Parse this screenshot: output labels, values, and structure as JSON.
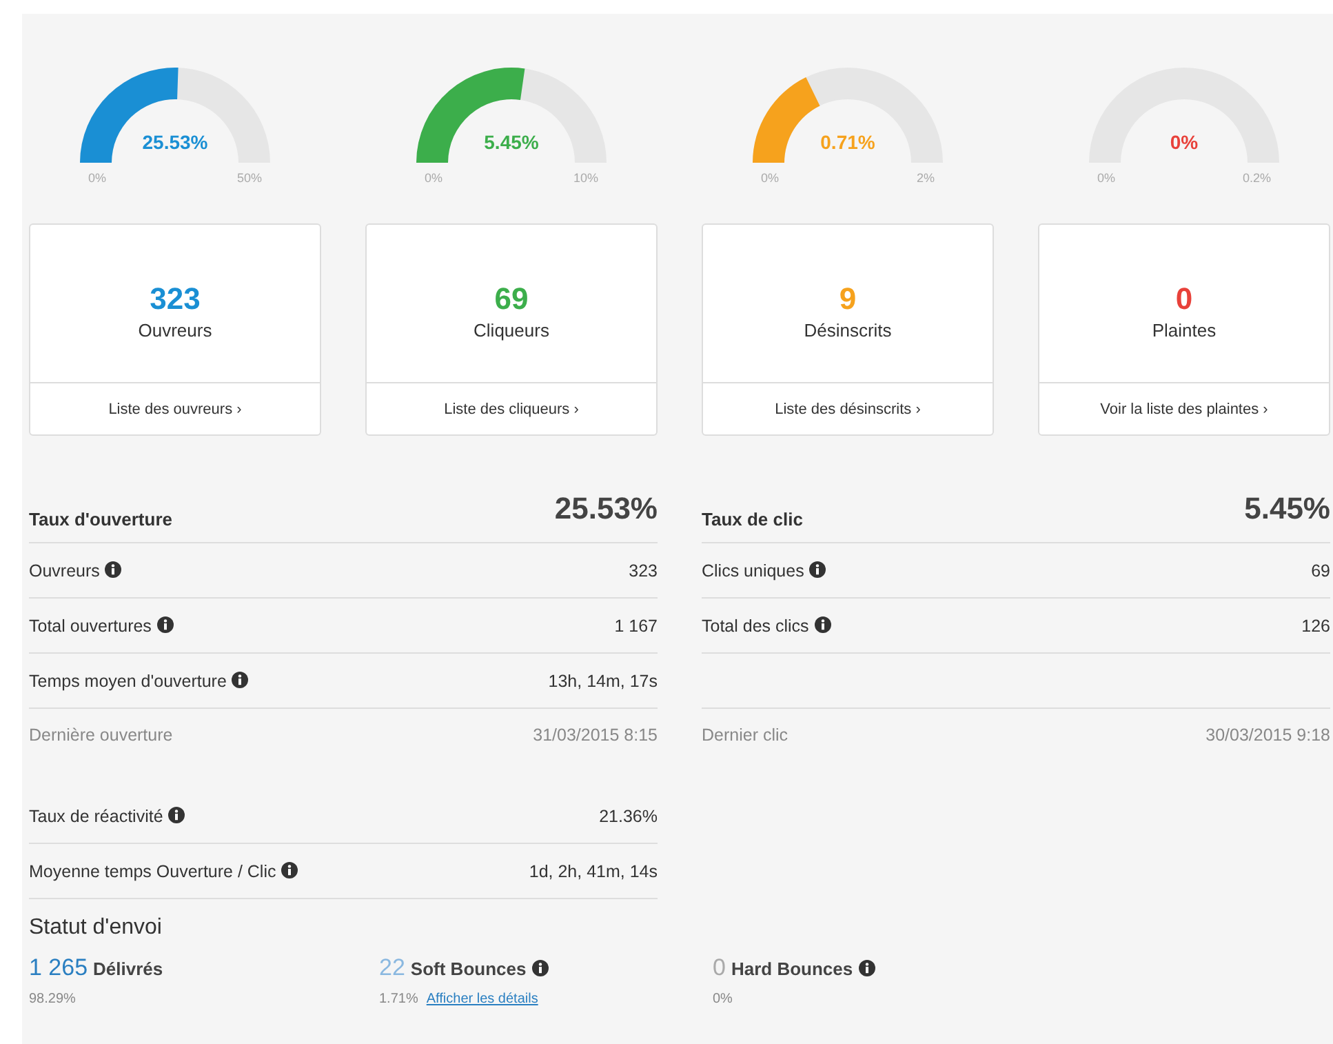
{
  "metrics": [
    {
      "gauge": {
        "value": "25.53%",
        "min": "0%",
        "max": "50%"
      },
      "count": "323",
      "label": "Ouvreurs",
      "link": "Liste des ouvreurs ›",
      "color": "#1a8fd4"
    },
    {
      "gauge": {
        "value": "5.45%",
        "min": "0%",
        "max": "10%"
      },
      "count": "69",
      "label": "Cliqueurs",
      "link": "Liste des cliqueurs ›",
      "color": "#3cae4b"
    },
    {
      "gauge": {
        "value": "0.71%",
        "min": "0%",
        "max": "2%"
      },
      "count": "9",
      "label": "Désinscrits",
      "link": "Liste des désinscrits ›",
      "color": "#f6a21d"
    },
    {
      "gauge": {
        "value": "0%",
        "min": "0%",
        "max": "0.2%"
      },
      "count": "0",
      "label": "Plaintes",
      "link": "Voir la liste des plaintes ›",
      "color": "#e8413a"
    }
  ],
  "open_stats": {
    "title": "Taux d'ouverture",
    "value": "25.53%",
    "rows": [
      {
        "label": "Ouvreurs",
        "info": true,
        "value": "323"
      },
      {
        "label": "Total ouvertures",
        "info": true,
        "value": "1 167"
      },
      {
        "label": "Temps moyen d'ouverture",
        "info": true,
        "value": "13h, 14m, 17s"
      }
    ],
    "last": {
      "label": "Dernière ouverture",
      "value": "31/03/2015 8:15"
    },
    "extra_rows": [
      {
        "label": "Taux de réactivité",
        "info": true,
        "value": "21.36%"
      },
      {
        "label": "Moyenne temps Ouverture / Clic",
        "info": true,
        "value": "1d, 2h, 41m, 14s"
      }
    ]
  },
  "click_stats": {
    "title": "Taux de clic",
    "value": "5.45%",
    "rows": [
      {
        "label": "Clics uniques",
        "info": true,
        "value": "69"
      },
      {
        "label": "Total des clics",
        "info": true,
        "value": "126"
      }
    ],
    "last": {
      "label": "Dernier clic",
      "value": "30/03/2015 9:18"
    }
  },
  "delivery": {
    "title": "Statut d'envoi",
    "items": [
      {
        "count": "1 265",
        "label": "Délivrés",
        "info": false,
        "percent": "98.29%",
        "color": "#2a7fc1"
      },
      {
        "count": "22",
        "label": "Soft Bounces",
        "info": true,
        "percent": "1.71%",
        "link": "Afficher les détails",
        "color": "#8ab8e0"
      },
      {
        "count": "0",
        "label": "Hard Bounces",
        "info": true,
        "percent": "0%",
        "color": "#aaaaaa"
      }
    ]
  }
}
